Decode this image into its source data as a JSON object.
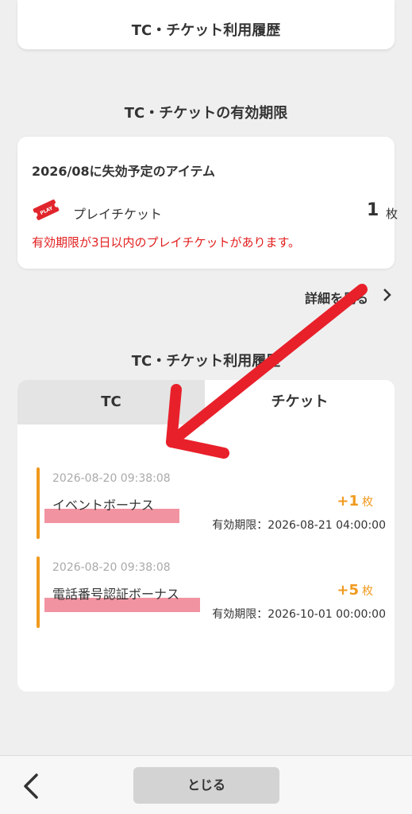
{
  "header": {
    "title": "TC・チケット利用履歴"
  },
  "expiry_section": {
    "title": "TC・チケットの有効期限",
    "card_heading": "2026/08に失効予定のアイテム",
    "ticket_icon_text": "PLAY",
    "item_name": "プレイチケット",
    "item_count": "1",
    "item_unit": "枚",
    "warning": "有効期限が3日以内のプレイチケットがあります。"
  },
  "detail_link": {
    "label": "詳細を見る"
  },
  "history_section": {
    "title": "TC・チケット利用履歴",
    "tabs": [
      {
        "label": "TC"
      },
      {
        "label": "チケット"
      }
    ],
    "entries": [
      {
        "datetime": "2026-08-20 09:38:08",
        "name": "イベントボーナス",
        "amount": "+1",
        "unit": "枚",
        "expiry": "有効期限：2026-08-21 04:00:00"
      },
      {
        "datetime": "2026-08-20 09:38:08",
        "name": "電話番号認証ボーナス",
        "amount": "+5",
        "unit": "枚",
        "expiry": "有効期限：2026-10-01 00:00:00"
      }
    ]
  },
  "footer": {
    "close_label": "とじる"
  },
  "colors": {
    "accent_orange": "#f09a1e",
    "warning_red": "#e21d1d",
    "annotation_red": "#e8202a",
    "highlight_pink": "#f08090"
  }
}
